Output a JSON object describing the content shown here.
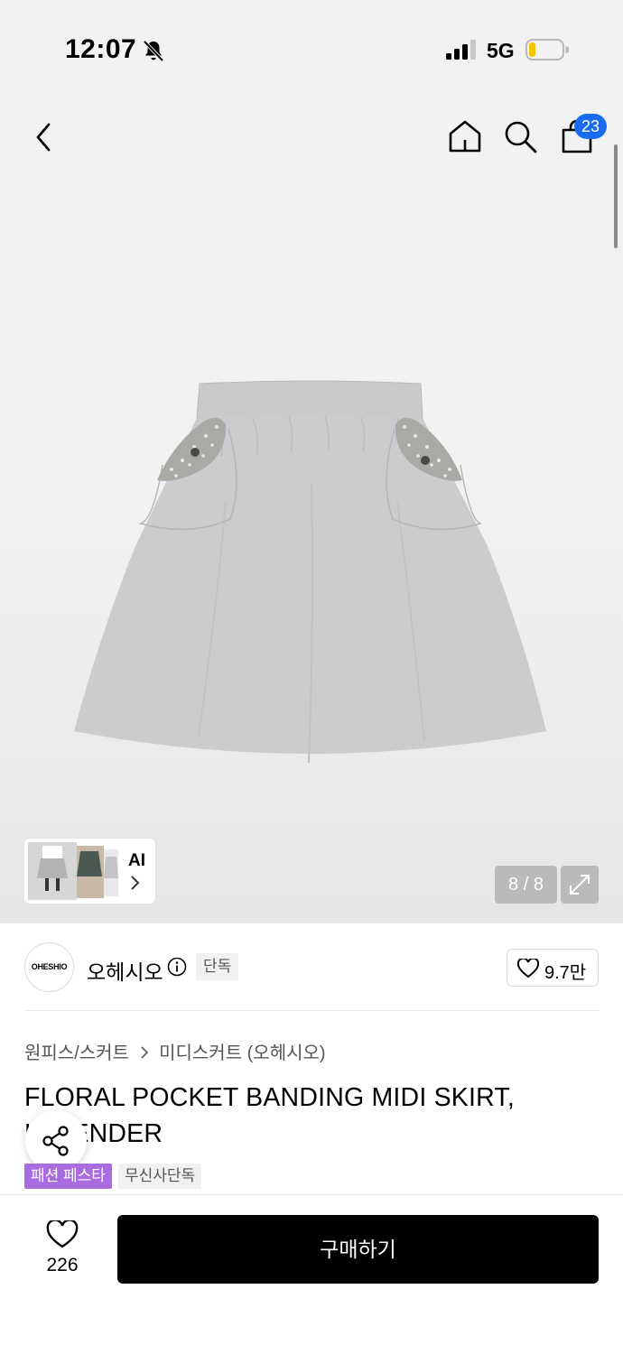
{
  "status_bar": {
    "time": "12:07",
    "network": "5G",
    "icons": [
      "bell-slash-icon",
      "signal-bars-icon",
      "battery-low-icon"
    ]
  },
  "nav": {
    "icons": [
      "chevron-left-icon",
      "home-icon",
      "search-icon",
      "shopping-bag-icon"
    ],
    "cart_badge": "23"
  },
  "gallery": {
    "thumbnail_label": "AI",
    "counter": "8 / 8",
    "expand_icon": "expand-arrows-icon"
  },
  "brand": {
    "logo_text": "OHESHIO",
    "name": "오헤시오",
    "exclusive_tag": "단독",
    "like_count": "9.7만"
  },
  "breadcrumb": {
    "category": "원피스/스커트",
    "subcategory": "미디스커트 (오헤시오)"
  },
  "product": {
    "title": "FLORAL POCKET BANDING MIDI SKIRT, LAVENDER",
    "tags": [
      "패션 페스타",
      "무신사단독"
    ]
  },
  "bottom_bar": {
    "wish_count": "226",
    "buy_label": "구매하기"
  },
  "colors": {
    "badge_blue": "#1b6bf2",
    "fest_purple": "#a86cdf",
    "buy_black": "#000000"
  }
}
